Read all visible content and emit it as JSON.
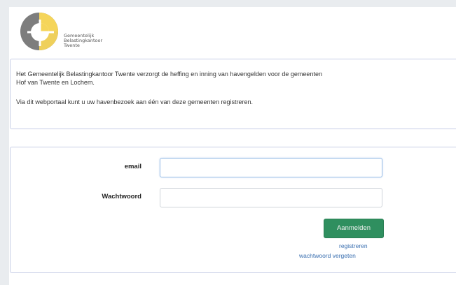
{
  "logo": {
    "line1": "Gemeentelijk",
    "line2": "Belastingkantoor",
    "line3": "Twente",
    "colors": {
      "grey": "#7d7d7d",
      "yellow": "#f5d55a"
    }
  },
  "intro": {
    "paragraph1_line1": "Het Gemeentelijk Belastingkantoor Twente verzorgt de heffing en inning van havengelden voor de gemeenten",
    "paragraph1_line2": "Hof van Twente en Lochem.",
    "paragraph2": "Via dit webportaal kunt u uw havenbezoek aan één van deze gemeenten registreren."
  },
  "login": {
    "email_label": "email",
    "email_value": "",
    "password_label": "Wachtwoord",
    "password_value": "",
    "submit_label": "Aanmelden",
    "register_link": "registreren",
    "forgot_link": "wachtwoord vergeten",
    "button_color": "#2f8f5f",
    "link_color": "#3a6fb0"
  }
}
